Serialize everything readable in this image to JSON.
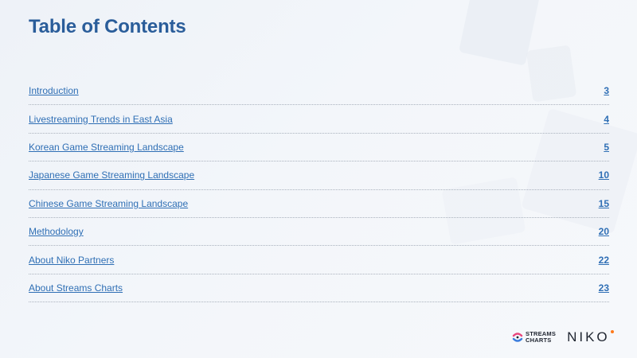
{
  "title": "Table of Contents",
  "toc": [
    {
      "label": "Introduction",
      "page": "3"
    },
    {
      "label": "Livestreaming Trends in East Asia",
      "page": "4"
    },
    {
      "label": "Korean Game Streaming Landscape",
      "page": "5"
    },
    {
      "label": "Japanese Game Streaming Landscape",
      "page": "10"
    },
    {
      "label": "Chinese Game Streaming Landscape",
      "page": "15"
    },
    {
      "label": "Methodology",
      "page": "20"
    },
    {
      "label": "About Niko Partners",
      "page": "22"
    },
    {
      "label": "About Streams Charts",
      "page": "23"
    }
  ],
  "logos": {
    "streams_line1": "STREAMS",
    "streams_line2": "CHARTS",
    "niko": "NIKO"
  },
  "colors": {
    "title": "#2a5d9a",
    "link": "#2f6fb5",
    "accent": "#ff7a1a"
  }
}
